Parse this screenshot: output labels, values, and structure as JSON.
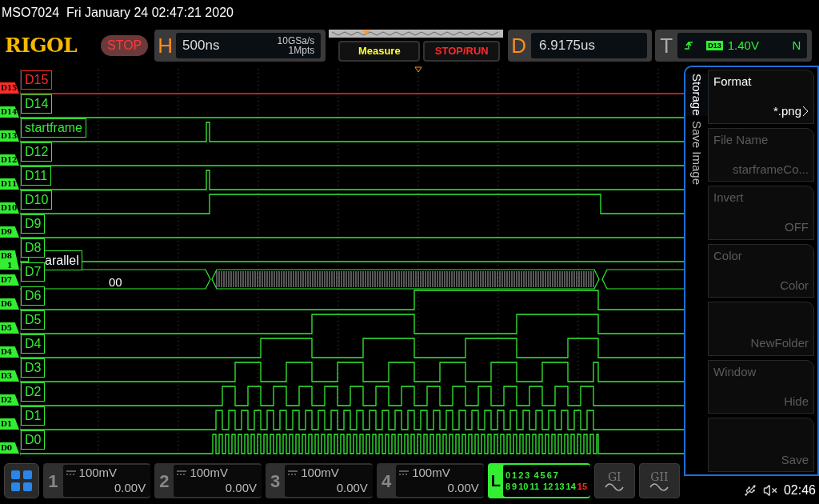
{
  "status_line": "MSO7024  Fri January 24 02:47:21 2020",
  "logo": "RIGOL",
  "run_state": "STOP",
  "horizontal": {
    "label": "H",
    "timebase": "500ns",
    "sample_rate": "10GSa/s",
    "memory_depth": "1Mpts"
  },
  "buttons": [
    {
      "label": "Measure",
      "kind": "measure"
    },
    {
      "label": "STOP/RUN",
      "kind": "stoprun"
    }
  ],
  "delay": {
    "label": "D",
    "value": "6.9175us"
  },
  "trigger": {
    "label": "T",
    "source": "D13",
    "level": "1.40V",
    "mode": "N"
  },
  "channels": [
    {
      "tab": "D15",
      "label": "D15",
      "color": "#ff2a2a"
    },
    {
      "tab": "D14",
      "label": "D14",
      "color": "#33ee33"
    },
    {
      "tab": "D13",
      "label": "startframe",
      "color": "#33ee33"
    },
    {
      "tab": "D12",
      "label": "D12",
      "color": "#33ee33"
    },
    {
      "tab": "D11",
      "label": "D11",
      "color": "#33ee33"
    },
    {
      "tab": "D10",
      "label": "D10",
      "color": "#33ee33"
    },
    {
      "tab": "D9",
      "label": "D9",
      "color": "#33ee33"
    },
    {
      "tab": "D8",
      "label": "D8",
      "color": "#33ee33",
      "bus_marker": "1"
    },
    {
      "tab": "D7",
      "label": "D7",
      "color": "#33ee33"
    },
    {
      "tab": "D6",
      "label": "D6",
      "color": "#33ee33"
    },
    {
      "tab": "D5",
      "label": "D5",
      "color": "#33ee33"
    },
    {
      "tab": "D4",
      "label": "D4",
      "color": "#33ee33"
    },
    {
      "tab": "D3",
      "label": "D3",
      "color": "#33ee33"
    },
    {
      "tab": "D2",
      "label": "D2",
      "color": "#33ee33"
    },
    {
      "tab": "D1",
      "label": "D1",
      "color": "#33ee33"
    },
    {
      "tab": "D0",
      "label": "D0",
      "color": "#33ee33"
    }
  ],
  "bus": {
    "label": "arallel",
    "value": "00"
  },
  "side_tabs": [
    {
      "label": "Storage",
      "selected": true
    },
    {
      "label": "Save Image",
      "selected": false
    }
  ],
  "softkeys": [
    {
      "title": "Format",
      "value": "*.png",
      "disabled": false,
      "submenu": true
    },
    {
      "title": "File Name",
      "value": "starframeCo...",
      "disabled": true,
      "submenu": false
    },
    {
      "title": "Invert",
      "value": "OFF",
      "disabled": true,
      "submenu": false
    },
    {
      "title": "Color",
      "value": "Color",
      "disabled": true,
      "submenu": false
    },
    {
      "value": "NewFolder",
      "disabled": true,
      "submenu": false
    },
    {
      "title": "Window",
      "value": "Hide",
      "disabled": true,
      "submenu": false
    },
    {
      "value": "Save",
      "disabled": true,
      "submenu": false
    }
  ],
  "analog_channels": [
    {
      "number": "1",
      "scale": "100mV",
      "offset": "0.00V"
    },
    {
      "number": "2",
      "scale": "100mV",
      "offset": "0.00V"
    },
    {
      "number": "3",
      "scale": "100mV",
      "offset": "0.00V"
    },
    {
      "number": "4",
      "scale": "100mV",
      "offset": "0.00V"
    }
  ],
  "logic": {
    "label": "L",
    "bits": [
      {
        "label": "0",
        "color": "#33ee33"
      },
      {
        "label": "1",
        "color": "#33ee33"
      },
      {
        "label": "2",
        "color": "#33ee33"
      },
      {
        "label": "3",
        "color": "#33ee33"
      },
      {
        "label": "4",
        "color": "#33ee33"
      },
      {
        "label": "5",
        "color": "#33ee33"
      },
      {
        "label": "6",
        "color": "#33ee33"
      },
      {
        "label": "7",
        "color": "#33ee33"
      },
      {
        "label": "8",
        "color": "#33ee33"
      },
      {
        "label": "9",
        "color": "#33ee33"
      },
      {
        "label": "10",
        "color": "#33ee33"
      },
      {
        "label": "11",
        "color": "#33ee33"
      },
      {
        "label": "12",
        "color": "#33ee33"
      },
      {
        "label": "13",
        "color": "#33ee33"
      },
      {
        "label": "14",
        "color": "#33ee33"
      },
      {
        "label": "15",
        "color": "#ff2a2a"
      }
    ]
  },
  "math": [
    "GI",
    "GII"
  ],
  "clock": "02:46"
}
